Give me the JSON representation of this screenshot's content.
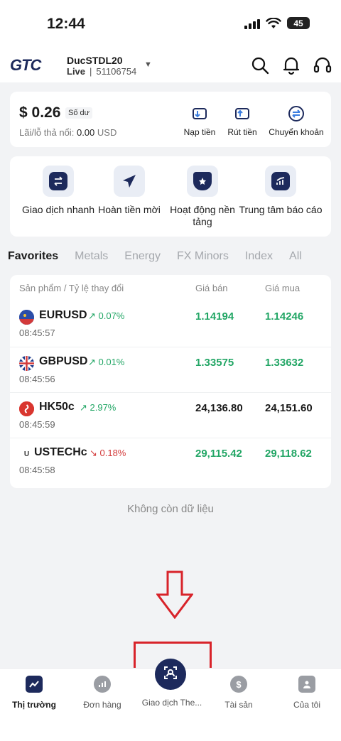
{
  "status": {
    "time": "12:44",
    "battery": "45"
  },
  "header": {
    "logo": "GTC",
    "account_name": "DucSTDL20",
    "account_type": "Live",
    "separator": "|",
    "account_id": "51106754"
  },
  "balance": {
    "amount": "$ 0.26",
    "tag": "Số dư",
    "pnl_label": "Lãi/lỗ thả nổi:",
    "pnl_value": "0.00",
    "pnl_currency": "USD",
    "actions": [
      {
        "label": "Nạp tiền",
        "icon": "deposit-icon"
      },
      {
        "label": "Rút tiền",
        "icon": "withdraw-icon"
      },
      {
        "label": "Chuyển khoản",
        "icon": "transfer-icon"
      }
    ]
  },
  "quick_actions": [
    {
      "label": "Giao dịch nhanh",
      "icon": "swap-icon"
    },
    {
      "label": "Hoàn tiền mời",
      "icon": "send-icon"
    },
    {
      "label": "Hoạt động nền tảng",
      "icon": "badge-icon"
    },
    {
      "label": "Trung tâm báo cáo",
      "icon": "report-icon"
    }
  ],
  "tabs": [
    "Favorites",
    "Metals",
    "Energy",
    "FX Minors",
    "Index",
    "All"
  ],
  "active_tab": "Favorites",
  "table": {
    "headers": {
      "product": "Sản phẩm / Tỷ lệ thay đổi",
      "bid": "Giá bán",
      "ask": "Giá mua"
    },
    "rows": [
      {
        "symbol": "EURUSD",
        "change": "↗ 0.07%",
        "direction": "up",
        "time": "08:45:57",
        "bid": "1.14194",
        "ask": "1.14246",
        "price_color": "up"
      },
      {
        "symbol": "GBPUSD",
        "change": "↗ 0.01%",
        "direction": "up",
        "time": "08:45:56",
        "bid": "1.33575",
        "ask": "1.33632",
        "price_color": "up"
      },
      {
        "symbol": "HK50c",
        "change": "↗ 2.97%",
        "direction": "up",
        "time": "08:45:59",
        "bid": "24,136.80",
        "ask": "24,151.60",
        "price_color": "neutral"
      },
      {
        "symbol": "USTECHc",
        "change": "↘ 0.18%",
        "direction": "down",
        "time": "08:45:58",
        "bid": "29,115.42",
        "ask": "29,118.62",
        "price_color": "up"
      }
    ]
  },
  "no_more": "Không còn dữ liệu",
  "bottom_nav": [
    {
      "label": "Thị trường",
      "icon": "market-icon"
    },
    {
      "label": "Đơn hàng",
      "icon": "orders-icon"
    },
    {
      "label": "Giao dịch The...",
      "icon": "copy-trade-icon"
    },
    {
      "label": "Tài sản",
      "icon": "assets-icon"
    },
    {
      "label": "Của tôi",
      "icon": "profile-icon"
    }
  ],
  "colors": {
    "brand": "#1d2a5c",
    "up": "#22a665",
    "down": "#d33a3a",
    "annotation": "#d8232a"
  }
}
